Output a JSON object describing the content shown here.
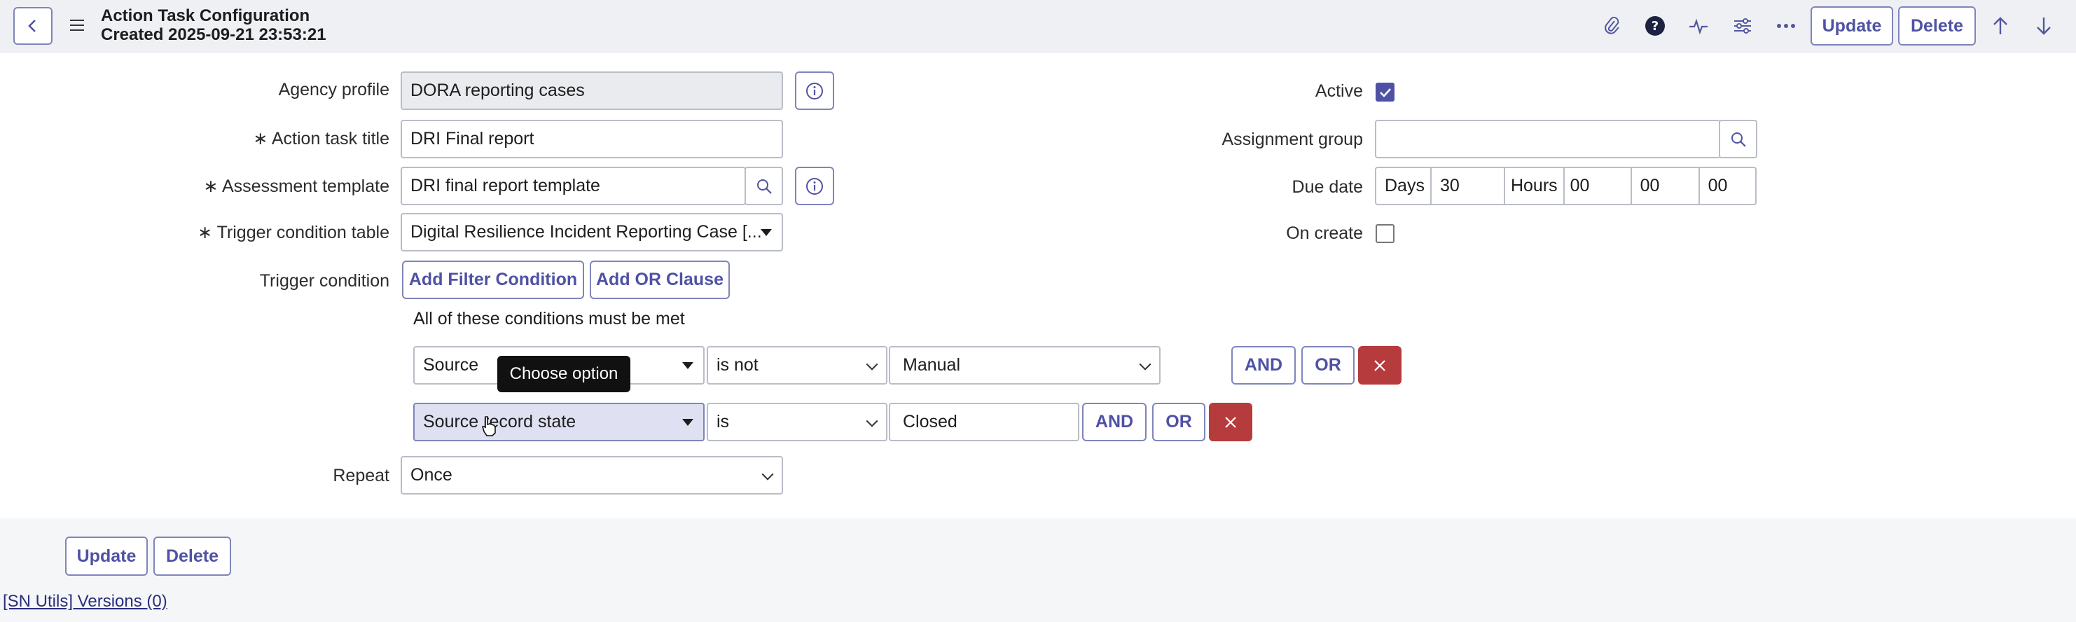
{
  "header": {
    "title": "Action Task Configuration",
    "subtitle": "Created 2025-09-21 23:53:21",
    "update_label": "Update",
    "delete_label": "Delete"
  },
  "form": {
    "agency_profile": {
      "label": "Agency profile",
      "value": "DORA reporting cases"
    },
    "action_task_title": {
      "required": "∗",
      "label": "Action task title",
      "value": "DRI Final report"
    },
    "assessment_template": {
      "required": "∗",
      "label": "Assessment template",
      "value": "DRI final report template"
    },
    "trigger_condition_table": {
      "required": "∗",
      "label": "Trigger condition table",
      "value": "Digital Resilience Incident Reporting Case [..."
    },
    "trigger_condition": {
      "label": "Trigger condition",
      "add_filter_label": "Add Filter Condition",
      "add_or_label": "Add OR Clause",
      "summary": "All of these conditions must be met",
      "rows": [
        {
          "field": "Source",
          "operator": "is not",
          "value": "Manual",
          "and_label": "AND",
          "or_label": "OR"
        },
        {
          "field": "Source record state",
          "operator": "is",
          "value": "Closed",
          "and_label": "AND",
          "or_label": "OR"
        }
      ],
      "tooltip": "Choose option"
    },
    "repeat": {
      "label": "Repeat",
      "value": "Once"
    },
    "active": {
      "label": "Active",
      "checked": true
    },
    "assignment_group": {
      "label": "Assignment group",
      "value": ""
    },
    "due_date": {
      "label": "Due date",
      "days_label": "Days",
      "days_value": "30",
      "hours_label": "Hours",
      "hours_value": "00",
      "minutes_value": "00",
      "seconds_value": "00"
    },
    "on_create": {
      "label": "On create",
      "checked": false
    }
  },
  "footer": {
    "update_label": "Update",
    "delete_label": "Delete",
    "link_text": "[SN Utils] Versions (0)"
  },
  "colors": {
    "accent": "#4f52a4",
    "danger": "#b63b3d",
    "header_bg": "#eef0f3"
  }
}
